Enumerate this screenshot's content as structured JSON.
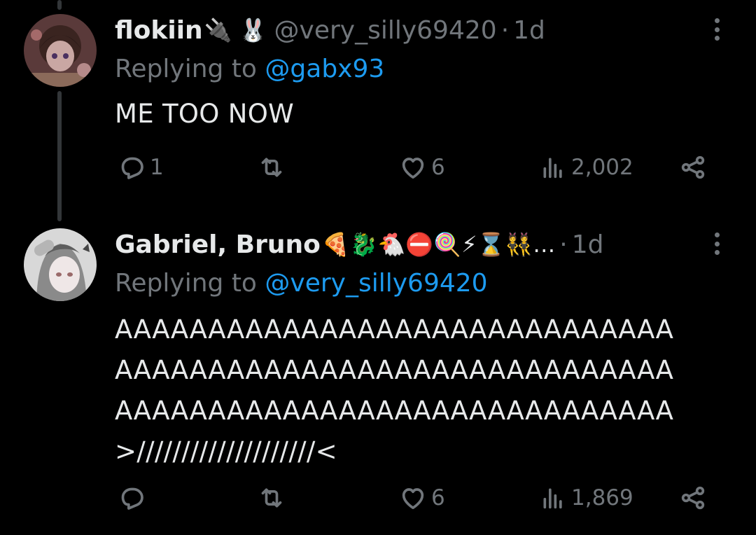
{
  "tweets": [
    {
      "name": "flokiin",
      "emoji": "🔌 🐰",
      "handle": "@very_silly69420",
      "separator": "·",
      "time": "1d",
      "replying_prefix": "Replying to",
      "replying_mention": "@gabx93",
      "text": "ME TOO NOW",
      "replies": "1",
      "retweets": "",
      "likes": "6",
      "views": "2,002"
    },
    {
      "name": "Gabriel, Bruno",
      "emoji": "🍕🐉🐔⛔🍭⚡⌛👯…",
      "separator": "·",
      "time": "1d",
      "replying_prefix": "Replying to",
      "replying_mention": "@very_silly69420",
      "text_lines": [
        "AAAAAAAAAAAAAAAAAAAAAAAAAAAAAA",
        "AAAAAAAAAAAAAAAAAAAAAAAAAAAAAA",
        "AAAAAAAAAAAAAAAAAAAAAAAAAAAAAA",
        ">////////////////////<"
      ],
      "replies": "",
      "retweets": "",
      "likes": "6",
      "views": "1,869"
    }
  ]
}
